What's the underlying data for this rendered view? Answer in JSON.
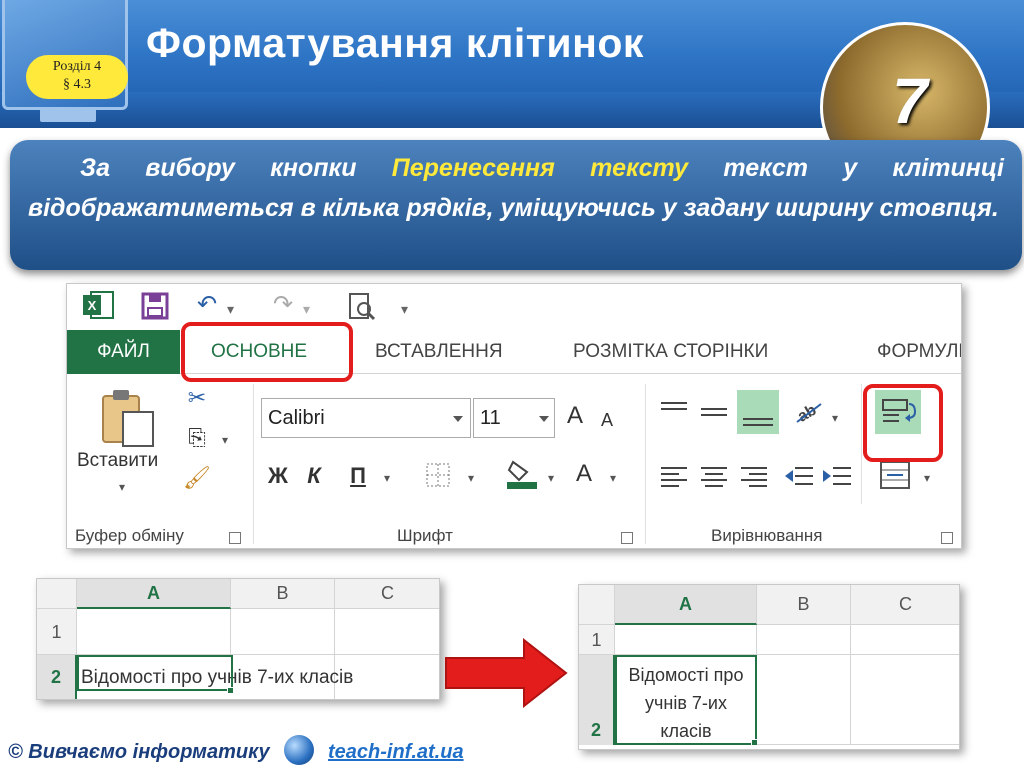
{
  "header": {
    "badge_line1": "Розділ 4",
    "badge_line2": "§ 4.3",
    "title": "Форматування клітинок",
    "logo_number": "7"
  },
  "description": {
    "before": "За вибору кнопки ",
    "highlight": "Перенесення тексту",
    "after": " текст у клітинці відображатиметься в кілька рядків, уміщуючись у задану ширину стовпця."
  },
  "ribbon": {
    "tabs": [
      "ФАЙЛ",
      "ОСНОВНЕ",
      "ВСТАВЛЕННЯ",
      "РОЗМІТКА СТОРІНКИ",
      "ФОРМУЛИ"
    ],
    "active_tab": "ОСНОВНЕ",
    "paste_label": "Вставити",
    "font_name": "Calibri",
    "font_size": "11",
    "font_grow": "A",
    "font_shrink": "A",
    "bold": "Ж",
    "italic": "К",
    "underline": "П",
    "font_color_letter": "A",
    "groups": [
      "Буфер обміну",
      "Шрифт",
      "Вирівнювання"
    ]
  },
  "sheet_before": {
    "columns": [
      "A",
      "B",
      "C"
    ],
    "rows": [
      "1",
      "2"
    ],
    "a2": "Відомості про учнів 7-их класів"
  },
  "sheet_after": {
    "columns": [
      "A",
      "B",
      "C"
    ],
    "rows": [
      "1",
      "2"
    ],
    "a2_line1": "Відомості про",
    "a2_line2": "учнів 7-их",
    "a2_line3": "класів"
  },
  "footer": {
    "left_text": "© Вивчаємо інформатику",
    "link": "teach-inf.at.ua"
  },
  "colors": {
    "excel_green": "#217346",
    "highlight_red": "#e31c1c",
    "header_blue": "#2e74c5",
    "accent_yellow": "#ffe93a"
  }
}
